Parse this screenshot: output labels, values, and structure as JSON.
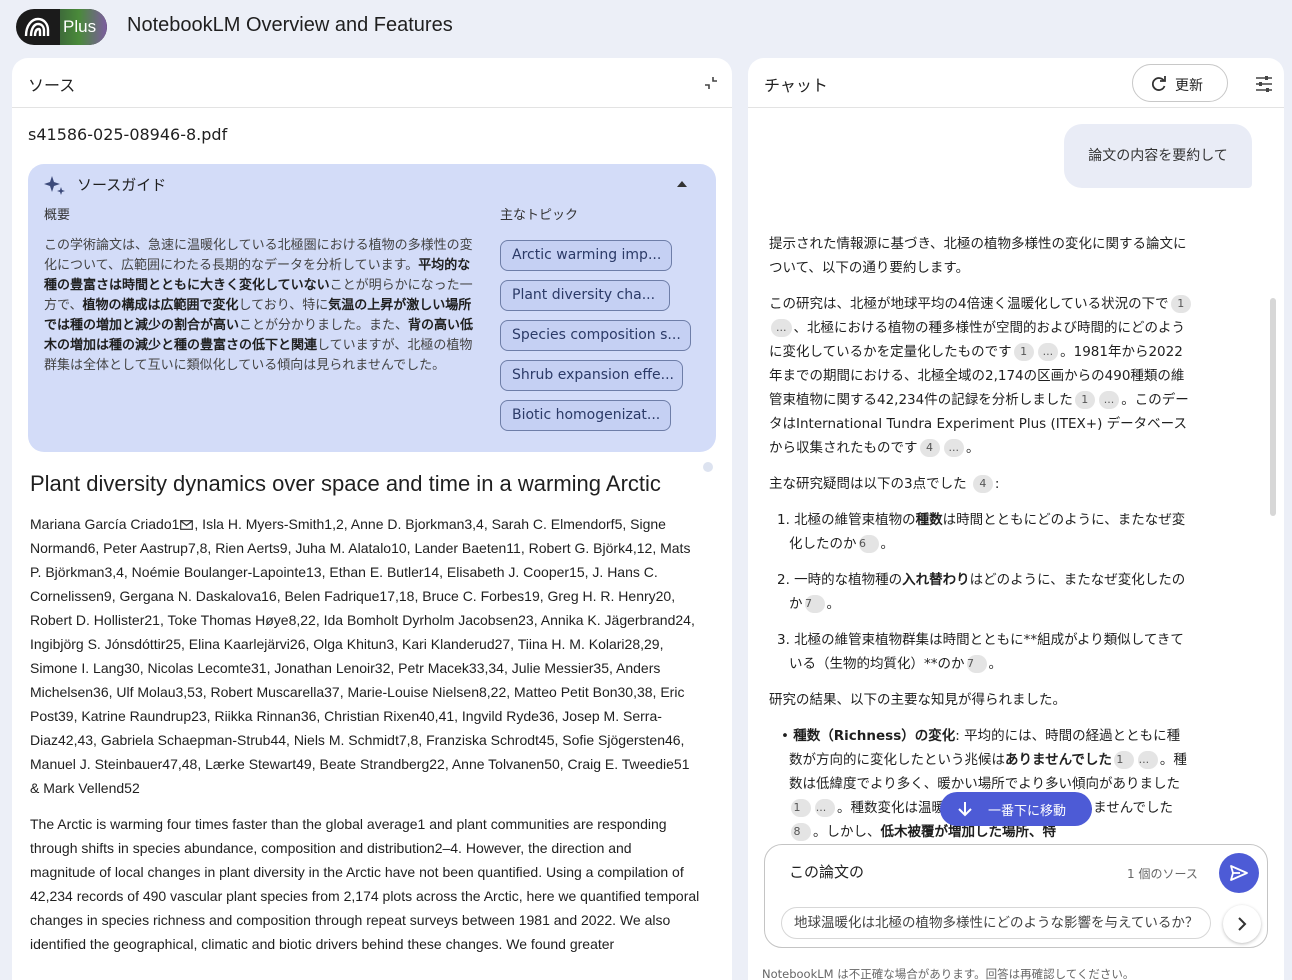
{
  "header": {
    "plan_badge": "Plus",
    "notebook_title": "NotebookLM Overview and Features"
  },
  "sources": {
    "panel_title": "ソース",
    "file_name": "s41586-025-08946-8.pdf",
    "guide": {
      "title": "ソースガイド",
      "summary_heading": "概要",
      "topics_heading": "主なトピック",
      "summary": [
        {
          "t": "この学術論文は、急速に温暖化している北極圏における植物の多様性の変化について、広範囲にわたる長期的なデータを分析しています。",
          "b": false
        },
        {
          "t": "平均的な種の豊富さは時間とともに大きく変化していない",
          "b": true
        },
        {
          "t": "ことが明らかになった一方で、",
          "b": false
        },
        {
          "t": "植物の構成は広範囲で変化",
          "b": true
        },
        {
          "t": "しており、特に",
          "b": false
        },
        {
          "t": "気温の上昇が激しい場所では種の増加と減少の割合が高い",
          "b": true
        },
        {
          "t": "ことが分かりました。また、",
          "b": false
        },
        {
          "t": "背の高い低木の増加は種の減少と種の豊富さの低下と関連",
          "b": true
        },
        {
          "t": "していますが、北極の植物群集は全体として互いに類似化している傾向は見られませんでした。",
          "b": false
        }
      ],
      "topics": [
        "Arctic warming imp...",
        "Plant diversity cha...",
        "Species composition s...",
        "Shrub expansion effe...",
        "Biotic homogenizat..."
      ]
    },
    "doc_title": "Plant diversity dynamics over space and time in a warming Arctic",
    "authors_first": "Mariana García Criado1",
    "authors_rest": ", Isla H. Myers-Smith1,2, Anne D. Bjorkman3,4, Sarah C. Elmendorf5, Signe Normand6, Peter Aastrup7,8, Rien Aerts9, Juha M. Alatalo10, Lander Baeten11, Robert G. Björk4,12, Mats P. Björkman3,4, Noémie Boulanger-Lapointe13, Ethan E. Butler14, Elisabeth J. Cooper15, J. Hans C. Cornelissen9, Gergana N. Daskalova16, Belen Fadrique17,18, Bruce C. Forbes19, Greg H. R. Henry20, Robert D. Hollister21, Toke Thomas Høye8,22, Ida Bomholt Dyrholm Jacobsen23, Annika K. Jägerbrand24, Ingibjörg S. Jónsdóttir25, Elina Kaarlejärvi26, Olga Khitun3, Kari Klanderud27, Tiina H. M. Kolari28,29, Simone I. Lang30, Nicolas Lecomte31, Jonathan Lenoir32, Petr Macek33,34, Julie Messier35, Anders Michelsen36, Ulf Molau3,53, Robert Muscarella37, Marie-Louise Nielsen8,22, Matteo Petit Bon30,38, Eric Post39, Katrine Raundrup23, Riikka Rinnan36, Christian Rixen40,41, Ingvild Ryde36, Josep M. Serra-Diaz42,43, Gabriela Schaepman-Strub44, Niels M. Schmidt7,8, Franziska Schrodt45, Sofie Sjögersten46, Manuel J. Steinbauer47,48, Lærke Stewart49, Beate Strandberg22, Anne Tolvanen50, Craig E. Tweedie51 & Mark Vellend52",
    "abstract": "The Arctic is warming four times faster than the global average1 and plant communities are responding through shifts in species abundance, composition and distribution2–4. However, the direction and magnitude of local changes in plant diversity in the Arctic have not been quantified. Using a compilation of 42,234 records of 490 vascular plant species from 2,174 plots across the Arctic, here we quantified temporal changes in species richness and composition through repeat surveys between 1981 and 2022. We also identified the geographical, climatic and biotic drivers behind these changes. We found greater"
  },
  "chat": {
    "panel_title": "チャット",
    "refresh_label": "更新",
    "user_message": "論文の内容を要約して",
    "jump_label": "一番下に移動",
    "input_value": "この論文の",
    "source_count": "1 個のソース",
    "suggestion": "地球温暖化は北極の植物多様性にどのような影響を与えているか？",
    "disclaimer": "NotebookLM は不正確な場合があります。回答は再確認してください。",
    "response": {
      "intro": "提示された情報源に基づき、北極の植物多様性の変化に関する論文について、以下の通り要約します。",
      "p1": [
        {
          "t": "この研究は、北極が地球平均の4倍速く温暖化している状況の下で"
        },
        {
          "c": "1"
        },
        {
          "c": "..."
        },
        {
          "t": "、北極における植物の種多様性が空間的および時間的にどのように変化しているかを定量化したものです"
        },
        {
          "c": "1"
        },
        {
          "c": "..."
        },
        {
          "t": "。1981年から2022年までの期間における、北極全域の2,174の区画からの490種類の維管束植物に関する42,234件の記録を分析しました"
        },
        {
          "c": "1"
        },
        {
          "c": "..."
        },
        {
          "t": "。このデータはInternational Tundra Experiment Plus (ITEX+) データベースから収集されたものです"
        },
        {
          "c": "4"
        },
        {
          "c": "..."
        },
        {
          "t": "。"
        }
      ],
      "questions_intro": "主な研究疑問は以下の3点でした",
      "questions_cite": "4",
      "q1": [
        {
          "t": "1. 北極の維管束植物の"
        },
        {
          "b": "種数"
        },
        {
          "t": "は時間とともにどのように、またなぜ変化したのか"
        },
        {
          "c": "6"
        },
        {
          "t": "。"
        }
      ],
      "q2": [
        {
          "t": "2. 一時的な植物種の"
        },
        {
          "b": "入れ替わり"
        },
        {
          "t": "はどのように、またなぜ変化したのか"
        },
        {
          "c": "7"
        },
        {
          "t": "。"
        }
      ],
      "q3": [
        {
          "t": "3. 北極の維管束植物群集は時間とともに**組成がより類似してきている（生物的均質化）**のか"
        },
        {
          "c": "7"
        },
        {
          "t": "。"
        }
      ],
      "results_intro": "研究の結果、以下の主要な知見が得られました。",
      "bullet1": [
        {
          "t": "• "
        },
        {
          "b": "種数（Richness）の変化"
        },
        {
          "t": ": 平均的には、時間の経過とともに種数が方向的に変化したという兆候は"
        },
        {
          "b": "ありませんでした"
        },
        {
          "c": "1"
        },
        {
          "c": "..."
        },
        {
          "t": "。種数は低緯度でより多く、暖かい場所でより多い傾向がありました"
        },
        {
          "c": "1"
        },
        {
          "c": "..."
        },
        {
          "t": "。種数変化は温暖化の傾向とは関連していませんでした"
        },
        {
          "c": "8"
        },
        {
          "t": "。しかし、"
        },
        {
          "b": "低木被覆が増加した場所、特"
        }
      ]
    }
  }
}
